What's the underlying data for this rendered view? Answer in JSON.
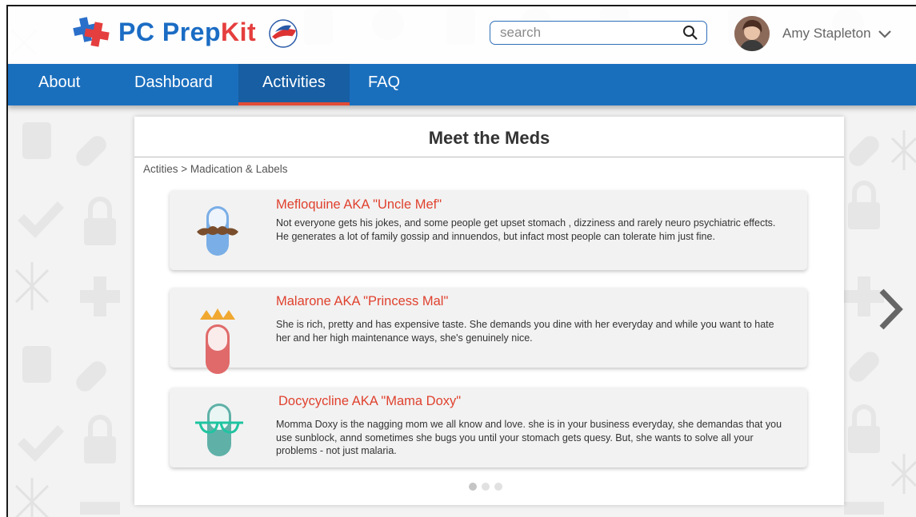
{
  "app": {
    "logo_text_pc": "PC Prep",
    "logo_text_kit": "Kit"
  },
  "search": {
    "placeholder": "search"
  },
  "user": {
    "name": "Amy Stapleton"
  },
  "nav": {
    "items": [
      {
        "label": "About"
      },
      {
        "label": "Dashboard"
      },
      {
        "label": "Activities"
      },
      {
        "label": "FAQ"
      }
    ],
    "active": "Activities"
  },
  "page": {
    "title": "Meet the Meds",
    "breadcrumb": "Actities > Madication & Labels"
  },
  "meds": [
    {
      "name": "Mefloquine AKA \"Uncle Mef\"",
      "description": "Not everyone gets his jokes, and some people get upset stomach , dizziness and  rarely neuro psychiatric effects. He generates a lot of family gossip and innuendos, but infact most people can tolerate him just fine.",
      "icon": "mustache-pill-icon"
    },
    {
      "name": "Malarone AKA \"Princess Mal\"",
      "description": "She is rich, pretty and has expensive taste. She demands you dine with her everyday and while you want to hate her and her high maintenance ways, she's genuinely nice.",
      "icon": "crown-pill-icon"
    },
    {
      "name": "Docycycline AKA \"Mama Doxy\"",
      "description": "Momma Doxy is the nagging mom we all know and love. she is in your business everyday, she demandas that you use sunblock, annd sometimes she bugs you until your stomach gets quesy. But, she wants to solve all your problems - not just malaria.",
      "icon": "glasses-pill-icon"
    }
  ],
  "pagination": {
    "pages": 3,
    "current": 1
  },
  "colors": {
    "brand_blue": "#1a6fbd",
    "accent_red": "#e0412e",
    "nav_active_underline": "#e24b37"
  }
}
